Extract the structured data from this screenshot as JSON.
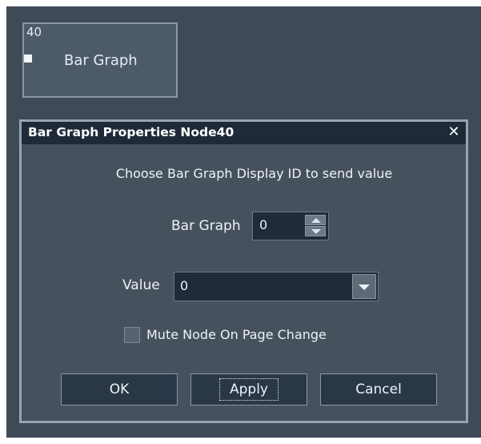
{
  "node": {
    "id": "40",
    "label": "Bar Graph"
  },
  "dialog": {
    "title": "Bar Graph Properties Node40",
    "close_symbol": "✕",
    "instruction": "Choose Bar Graph Display ID to send value",
    "bar_graph": {
      "label": "Bar Graph",
      "value": "0"
    },
    "value_field": {
      "label": "Value",
      "selected": "0"
    },
    "mute_checkbox": {
      "label": "Mute Node On Page Change",
      "checked": false
    },
    "buttons": {
      "ok": "OK",
      "apply": "Apply",
      "cancel": "Cancel"
    }
  },
  "colors": {
    "canvas_bg": "#3f4a57",
    "titlebar_bg": "#1e2a38",
    "dialog_bg": "#46515e",
    "field_bg": "#1f2b3a"
  },
  "icons": {
    "close": "close-icon",
    "spin_up": "chevron-up-icon",
    "spin_down": "chevron-down-icon",
    "dropdown": "caret-down-icon",
    "port": "input-port-icon"
  }
}
